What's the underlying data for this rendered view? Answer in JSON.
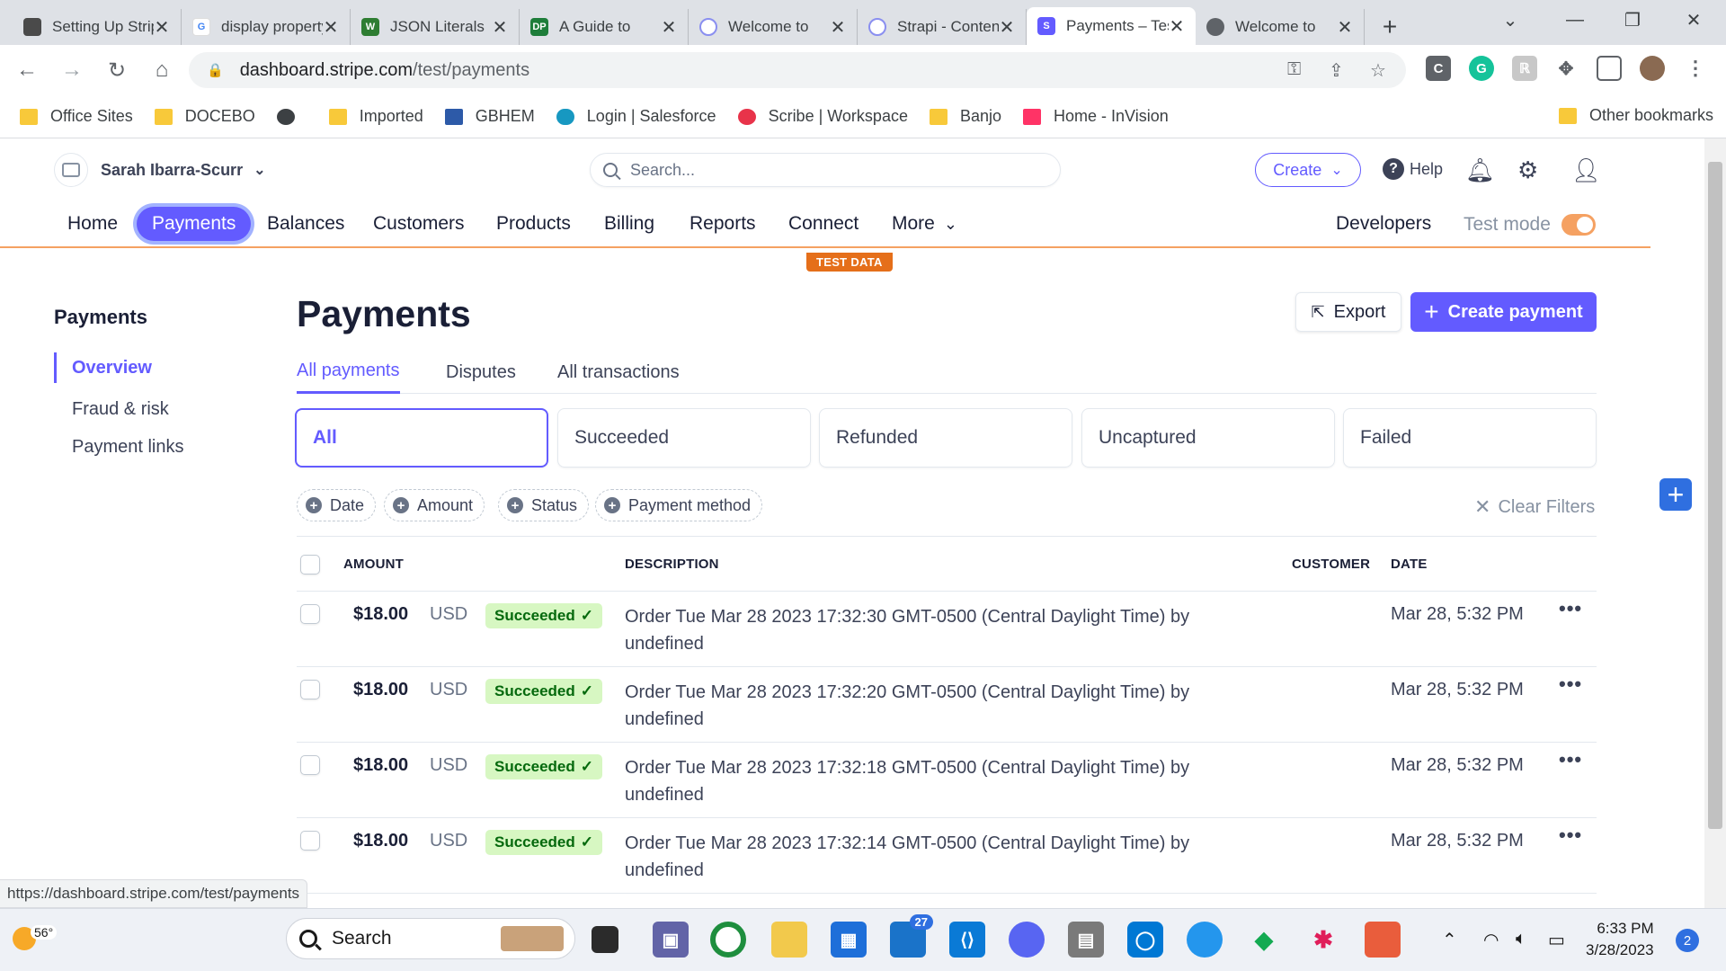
{
  "browser": {
    "tabs": [
      {
        "title": "Setting Up Stripe",
        "favicon_color": "#4a4a4a"
      },
      {
        "title": "display property",
        "favicon_color": "#4285f4"
      },
      {
        "title": "JSON Literals",
        "favicon_color": "#2e7d32"
      },
      {
        "title": "A Guide to",
        "favicon_color": "#1e7d3a"
      },
      {
        "title": "Welcome to",
        "favicon_color": "#8a8ff0"
      },
      {
        "title": "Strapi - Content",
        "favicon_color": "#8a8ff0"
      },
      {
        "title": "Payments – Test",
        "favicon_color": "#635bff"
      },
      {
        "title": "Welcome to",
        "favicon_color": "#5f6368"
      }
    ],
    "url_host": "dashboard.stripe.com",
    "url_path": "/test/payments",
    "status_url": "https://dashboard.stripe.com/test/payments",
    "bookmarks": [
      {
        "label": "Office Sites",
        "icon": "folder-icon"
      },
      {
        "label": "DOCEBO",
        "icon": "folder-icon"
      },
      {
        "label": "",
        "icon": "globe-icon"
      },
      {
        "label": "Imported",
        "icon": "folder-icon"
      },
      {
        "label": "GBHEM",
        "icon": "site-icon"
      },
      {
        "label": "Login | Salesforce",
        "icon": "cloud-icon"
      },
      {
        "label": "Scribe | Workspace",
        "icon": "site-icon"
      },
      {
        "label": "Banjo",
        "icon": "folder-icon"
      },
      {
        "label": "Home - InVision",
        "icon": "site-icon"
      }
    ],
    "other_bookmarks": "Other bookmarks"
  },
  "header": {
    "account_name": "Sarah Ibarra-Scurr",
    "search_placeholder": "Search...",
    "create_label": "Create",
    "help_label": "Help"
  },
  "nav": {
    "items": [
      "Home",
      "Payments",
      "Balances",
      "Customers",
      "Products",
      "Billing",
      "Reports",
      "Connect",
      "More"
    ],
    "active": "Payments",
    "developers": "Developers",
    "test_mode": "Test mode",
    "test_data_badge": "TEST DATA"
  },
  "sidebar": {
    "title": "Payments",
    "items": [
      "Overview",
      "Fraud & risk",
      "Payment links"
    ]
  },
  "page": {
    "title": "Payments",
    "export_label": "Export",
    "create_payment_label": "Create payment",
    "tabs": [
      "All payments",
      "Disputes",
      "All transactions"
    ],
    "status_filters": [
      "All",
      "Succeeded",
      "Refunded",
      "Uncaptured",
      "Failed"
    ],
    "filter_chips": [
      "Date",
      "Amount",
      "Status",
      "Payment method"
    ],
    "clear_filters": "Clear Filters"
  },
  "table": {
    "columns": {
      "amount": "AMOUNT",
      "description": "DESCRIPTION",
      "customer": "CUSTOMER",
      "date": "DATE"
    },
    "rows": [
      {
        "amount": "$18.00",
        "currency": "USD",
        "status": "Succeeded",
        "description": "Order Tue Mar 28 2023 17:32:30 GMT-0500 (Central Daylight Time) by undefined",
        "customer": "",
        "date": "Mar 28, 5:32 PM"
      },
      {
        "amount": "$18.00",
        "currency": "USD",
        "status": "Succeeded",
        "description": "Order Tue Mar 28 2023 17:32:20 GMT-0500 (Central Daylight Time) by undefined",
        "customer": "",
        "date": "Mar 28, 5:32 PM"
      },
      {
        "amount": "$18.00",
        "currency": "USD",
        "status": "Succeeded",
        "description": "Order Tue Mar 28 2023 17:32:18 GMT-0500 (Central Daylight Time) by undefined",
        "customer": "",
        "date": "Mar 28, 5:32 PM"
      },
      {
        "amount": "$18.00",
        "currency": "USD",
        "status": "Succeeded",
        "description": "Order Tue Mar 28 2023 17:32:14 GMT-0500 (Central Daylight Time) by undefined",
        "customer": "",
        "date": "Mar 28, 5:32 PM"
      }
    ]
  },
  "taskbar": {
    "temperature": "56°",
    "search_label": "Search",
    "teams_badge": "27",
    "time": "6:33 PM",
    "date": "3/28/2023",
    "notification_count": "2"
  },
  "colors": {
    "accent": "#635bff",
    "test_orange": "#f5a162",
    "succeeded_bg": "#d7f7c2",
    "succeeded_text": "#05690d"
  }
}
